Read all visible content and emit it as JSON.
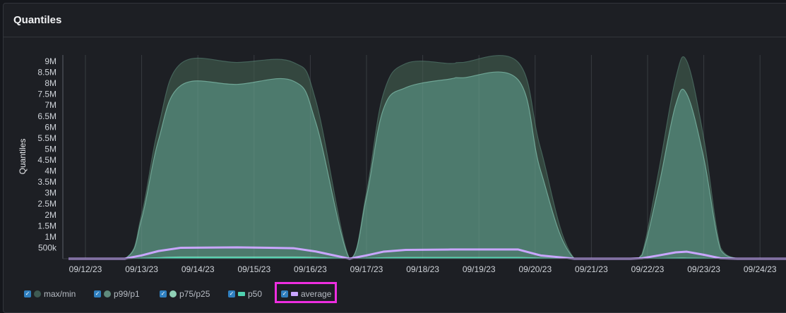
{
  "panel": {
    "title": "Quantiles"
  },
  "legend": [
    {
      "label": "max/min",
      "color": "#3e5a52",
      "shape": "dot"
    },
    {
      "label": "p99/p1",
      "color": "#5f8a7c",
      "shape": "dot"
    },
    {
      "label": "p75/p25",
      "color": "#8fcfb5",
      "shape": "dot"
    },
    {
      "label": "p50",
      "color": "#4fd1b0",
      "shape": "bar"
    },
    {
      "label": "average",
      "color": "#c9a6ff",
      "shape": "bar"
    }
  ],
  "chart_data": {
    "type": "area",
    "ylabel": "Quantiles",
    "ylim": [
      0,
      9300000
    ],
    "y_ticks": [
      "500k",
      "1M",
      "1.5M",
      "2M",
      "2.5M",
      "3M",
      "3.5M",
      "4M",
      "4.5M",
      "5M",
      "5.5M",
      "6M",
      "6.5M",
      "7M",
      "7.5M",
      "8M",
      "8.5M",
      "9M"
    ],
    "x_ticks": [
      "09/12/23",
      "09/13/23",
      "09/14/23",
      "09/15/23",
      "09/16/23",
      "09/17/23",
      "09/18/23",
      "09/19/23",
      "09/20/23",
      "09/21/23",
      "09/22/23",
      "09/23/23",
      "09/24/23"
    ],
    "x": [
      0,
      1,
      1.3,
      1.6,
      2,
      3,
      4,
      4.4,
      5,
      5.3,
      5.6,
      6,
      6.8,
      7,
      8,
      8.4,
      9,
      10,
      10.2,
      10.5,
      10.8,
      11,
      11.3,
      11.6,
      11.9,
      12,
      13
    ],
    "series": [
      {
        "name": "max/min",
        "values": [
          0,
          0,
          2000000,
          6000000,
          8900000,
          8950000,
          8950000,
          7200000,
          0,
          3000000,
          7500000,
          8900000,
          8900000,
          8950000,
          8950000,
          5000000,
          0,
          0,
          200000,
          4000000,
          8200000,
          9000000,
          5500000,
          500000,
          0,
          0,
          0
        ]
      },
      {
        "name": "p99/p1",
        "values": [
          0,
          0,
          1800000,
          5400000,
          7900000,
          7950000,
          8100000,
          6200000,
          0,
          2800000,
          6800000,
          7800000,
          8200000,
          8250000,
          8150000,
          4000000,
          0,
          0,
          150000,
          3300000,
          7000000,
          7500000,
          4600000,
          400000,
          0,
          0,
          0
        ]
      },
      {
        "name": "p75/p25",
        "values": [
          0,
          0,
          20000,
          50000,
          80000,
          80000,
          80000,
          60000,
          0,
          20000,
          50000,
          60000,
          60000,
          60000,
          60000,
          30000,
          0,
          0,
          0,
          10000,
          30000,
          30000,
          20000,
          0,
          0,
          0,
          0
        ]
      },
      {
        "name": "p50",
        "values": [
          0,
          0,
          15000,
          40000,
          60000,
          60000,
          60000,
          45000,
          0,
          15000,
          40000,
          50000,
          50000,
          50000,
          50000,
          20000,
          0,
          0,
          0,
          8000,
          20000,
          20000,
          12000,
          0,
          0,
          0,
          0
        ]
      },
      {
        "name": "average",
        "values": [
          0,
          0,
          150000,
          350000,
          500000,
          520000,
          480000,
          330000,
          0,
          150000,
          320000,
          400000,
          420000,
          420000,
          420000,
          150000,
          0,
          0,
          20000,
          150000,
          290000,
          320000,
          180000,
          20000,
          0,
          0,
          0
        ]
      }
    ]
  }
}
